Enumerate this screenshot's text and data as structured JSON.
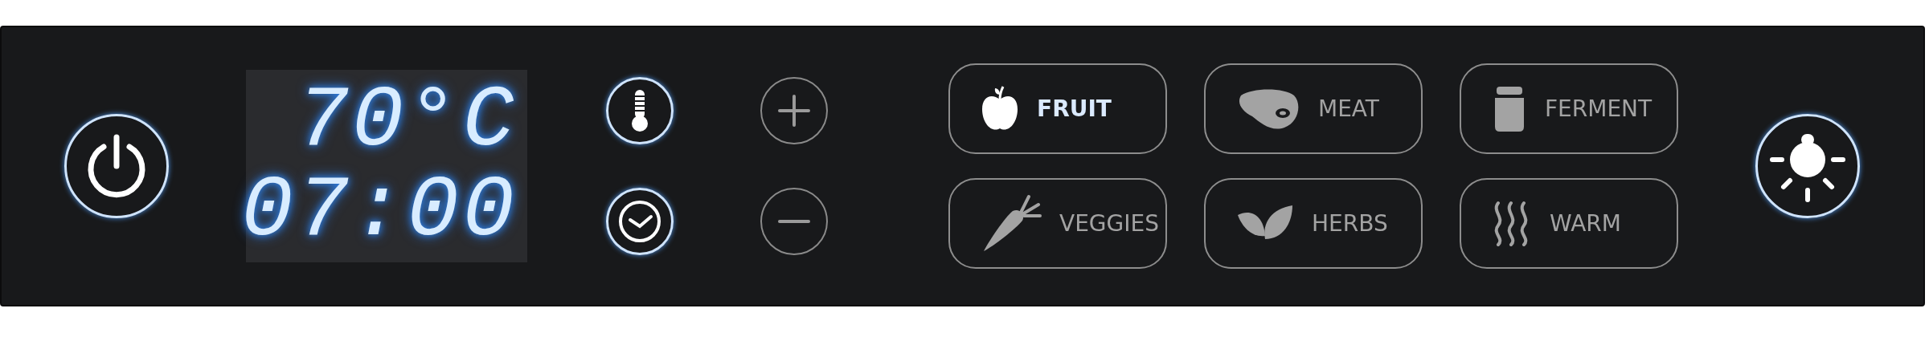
{
  "display": {
    "temperature": "70°C",
    "time": "07:00"
  },
  "setting_buttons": [
    {
      "kind": "temperature"
    },
    {
      "kind": "timer"
    }
  ],
  "adjust_buttons": [
    {
      "kind": "plus"
    },
    {
      "kind": "minus"
    }
  ],
  "modes": [
    {
      "label": "FRUIT",
      "kind": "fruit",
      "selected": true
    },
    {
      "label": "MEAT",
      "kind": "meat",
      "selected": false
    },
    {
      "label": "FERMENT",
      "kind": "ferment",
      "selected": false
    },
    {
      "label": "VEGGIES",
      "kind": "veggies",
      "selected": false
    },
    {
      "label": "HERBS",
      "kind": "herbs",
      "selected": false
    },
    {
      "label": "WARM",
      "kind": "warm",
      "selected": false
    }
  ]
}
